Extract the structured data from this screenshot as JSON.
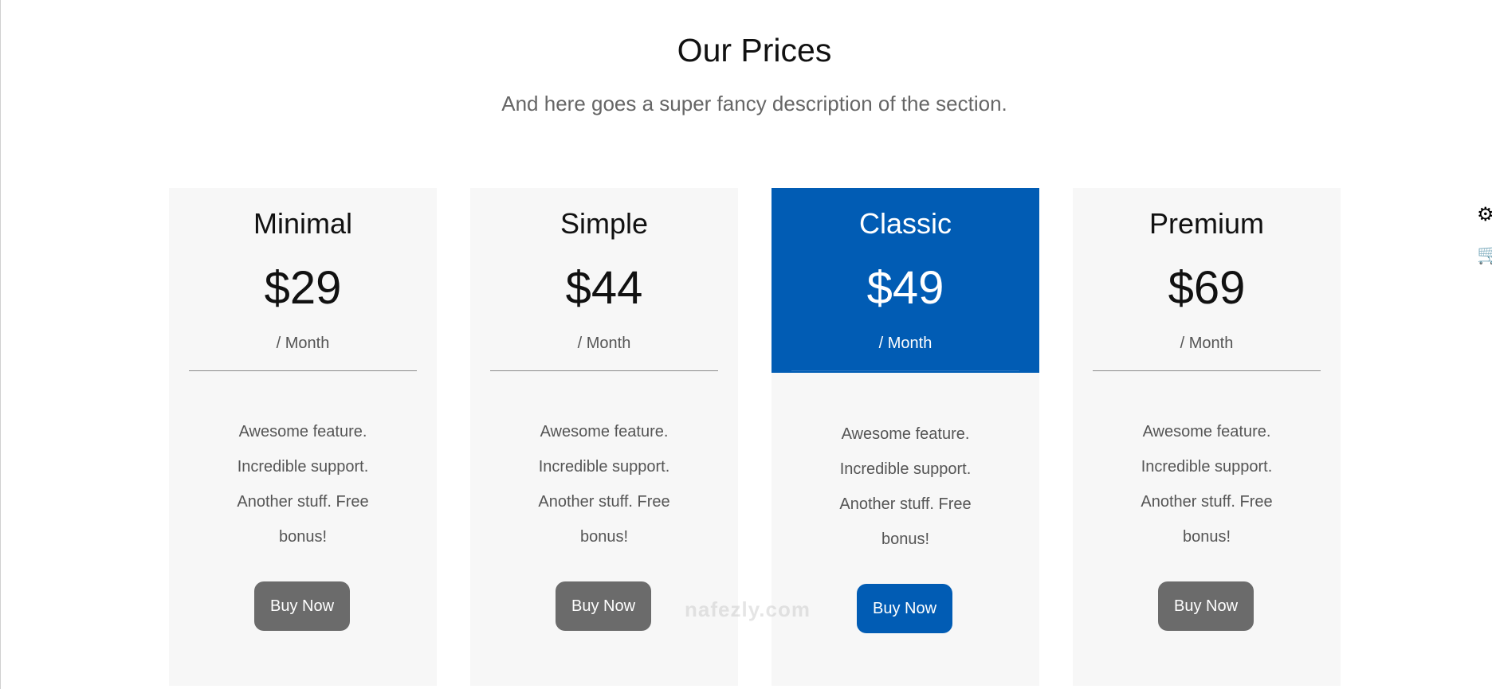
{
  "section": {
    "title": "Our Prices",
    "description": "And here goes a super fancy description of the section."
  },
  "plans": [
    {
      "name": "Minimal",
      "price": "$29",
      "period": "/ Month",
      "features": [
        "Awesome feature.",
        "Incredible support.",
        "Another stuff. Free",
        "bonus!"
      ],
      "button": "Buy Now",
      "featured": false
    },
    {
      "name": "Simple",
      "price": "$44",
      "period": "/ Month",
      "features": [
        "Awesome feature.",
        "Incredible support.",
        "Another stuff. Free",
        "bonus!"
      ],
      "button": "Buy Now",
      "featured": false
    },
    {
      "name": "Classic",
      "price": "$49",
      "period": "/ Month",
      "features": [
        "Awesome feature.",
        "Incredible support.",
        "Another stuff. Free",
        "bonus!"
      ],
      "button": "Buy Now",
      "featured": true
    },
    {
      "name": "Premium",
      "price": "$69",
      "period": "/ Month",
      "features": [
        "Awesome feature.",
        "Incredible support.",
        "Another stuff. Free",
        "bonus!"
      ],
      "button": "Buy Now",
      "featured": false
    }
  ],
  "side_icons": [
    {
      "name": "gears-icon",
      "glyph": "⚙"
    },
    {
      "name": "cart-icon",
      "glyph": "🛒"
    }
  ],
  "watermark": {
    "text": "nafezly.com"
  },
  "colors": {
    "accent": "#015cb4",
    "card_bg": "#f7f7f7",
    "button_gray": "#6b6b6b"
  }
}
